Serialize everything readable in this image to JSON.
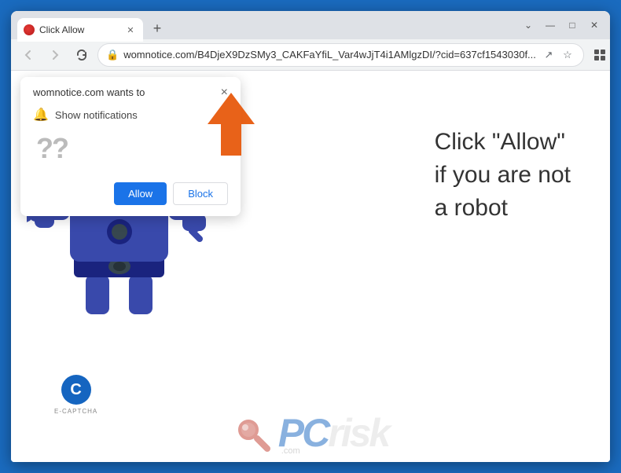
{
  "browser": {
    "tab_title": "Click Allow",
    "tab_favicon": "red-circle",
    "url": "womnotice.com/B4DjeX9DzSMy3_CAKFaYfiL_Var4wJjT4i1AMlgzDI/?cid=637cf1543030f...",
    "url_full": "womnotice.com/B4DjeX9DzSMy3_CAKFaYfiL_Var4wJjT4i1AMlgzDI/?cid=637cf1543030f...",
    "window_controls": {
      "minimize": "—",
      "maximize": "□",
      "close": "✕"
    }
  },
  "notification_popup": {
    "title": "womnotice.com wants to",
    "description": "Show notifications",
    "question_marks": "??",
    "allow_label": "Allow",
    "block_label": "Block",
    "close_label": "×"
  },
  "page": {
    "main_text_line1": "Click \"Allow\"",
    "main_text_line2": "if you are not",
    "main_text_line3": "a robot",
    "captcha_letter": "C",
    "captcha_label": "E-CAPTCHA",
    "pcrisk": "PCrisk.com"
  },
  "nav": {
    "back": "←",
    "forward": "→",
    "refresh": "↻"
  }
}
